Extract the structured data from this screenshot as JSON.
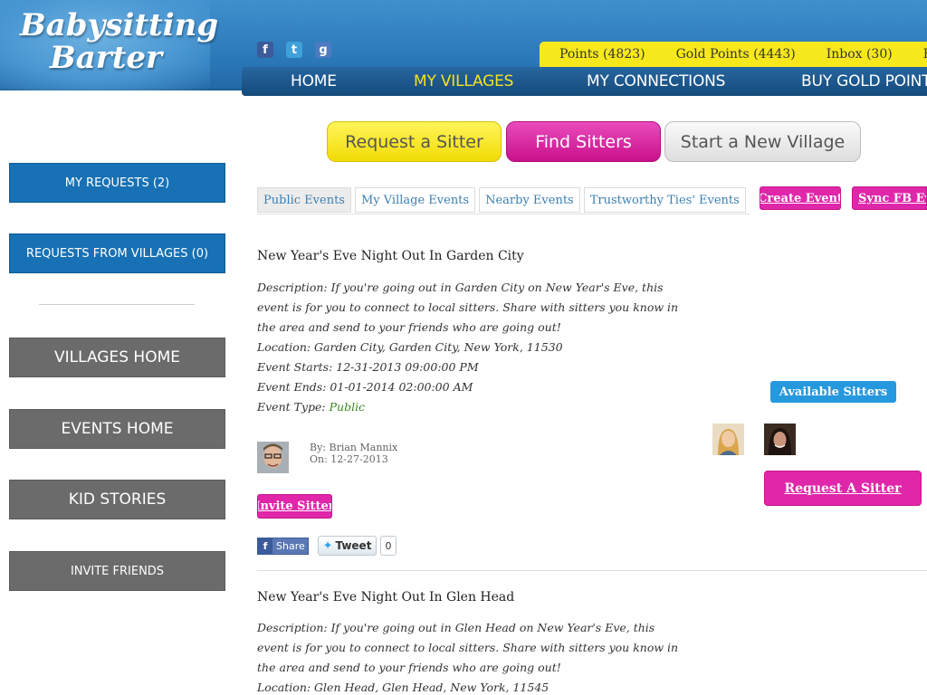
{
  "header": {
    "logo_line1": "Babysitting",
    "logo_line2": "Barter",
    "social": [
      {
        "icon": "facebook-icon",
        "glyph": "f"
      },
      {
        "icon": "twitter-icon",
        "glyph": "t"
      },
      {
        "icon": "google-plus-icon",
        "glyph": "g"
      }
    ],
    "points": "Points (4823)",
    "gold_points": "Gold Points (4443)",
    "inbox": "Inbox (30)",
    "user": "Brian M",
    "nav": {
      "home": "HOME",
      "villages": "MY VILLAGES",
      "connections": "MY CONNECTIONS",
      "gold": "BUY GOLD POINTS"
    }
  },
  "actions": {
    "request": "Request a Sitter",
    "find": "Find Sitters",
    "new_village": "Start a New Village"
  },
  "sidebar": {
    "my_requests": "MY REQUESTS (2)",
    "village_requests": "REQUESTS FROM VILLAGES (0)",
    "villages_home": "VILLAGES HOME",
    "events_home": "EVENTS HOME",
    "kid_stories": "KID STORIES",
    "invite_friends": "INVITE FRIENDS"
  },
  "tabs": {
    "public": "Public Events",
    "village": "My Village Events",
    "nearby": "Nearby Events",
    "trustworthy": "Trustworthy Ties' Events"
  },
  "toolbar": {
    "create_event": "Create Event",
    "sync_fb": "Sync FB Events"
  },
  "events": [
    {
      "title": "New Year's Eve Night Out In Garden City",
      "description": "Description: If you're going out in Garden City on New Year's Eve, this event is for you to connect to local sitters. Share with sitters you know in the area and send to your friends who are going out!",
      "location": "Location: Garden City, Garden City, New York, 11530",
      "starts": "Event Starts: 12-31-2013 09:00:00 PM",
      "ends": "Event Ends: 01-01-2014 02:00:00 AM",
      "type_label": "Event Type: ",
      "type_value": "Public",
      "by": "By: Brian Mannix",
      "on": "On: 12-27-2013",
      "invite": "Invite Sitter",
      "share": "Share",
      "tweet": "Tweet",
      "tweet_count": "0",
      "available": "Available Sitters",
      "request": "Request A Sitter"
    },
    {
      "title": "New Year's Eve Night Out In Glen Head",
      "description": "Description: If you're going out in Glen Head on New Year's Eve, this event is for you to connect to local sitters. Share with sitters you know in the area and send to your friends who are going out!",
      "location": "Location: Glen Head, Glen Head, New York, 11545"
    }
  ]
}
